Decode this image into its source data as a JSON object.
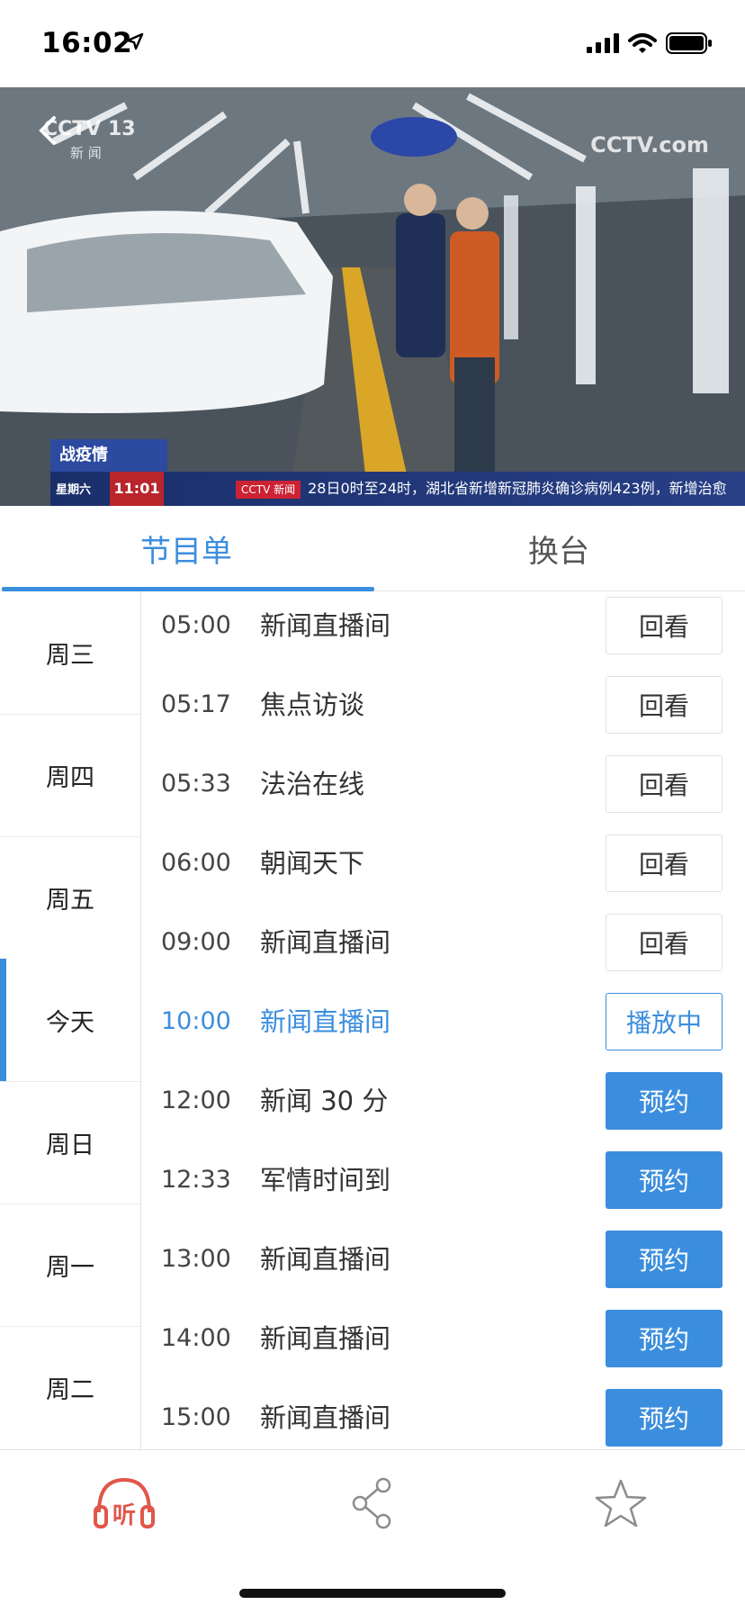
{
  "status_bar": {
    "time": "16:02",
    "icons": [
      "location-arrow-icon",
      "signal-icon",
      "wifi-icon",
      "battery-icon"
    ]
  },
  "video": {
    "watermark_left": "CCTV 13",
    "watermark_left_sub": "新 闻",
    "watermark_right": "CCTV.com",
    "corner_tag": "战疫情",
    "ticker_day": "星期六",
    "ticker_time": "11:01",
    "ticker_logo": "CCTV 新闻",
    "ticker_text": "28日0时至24时，湖北省新增新冠肺炎确诊病例423例，新增治愈"
  },
  "tabs": [
    {
      "label": "节目单",
      "active": true
    },
    {
      "label": "换台",
      "active": false
    }
  ],
  "days": [
    {
      "label": "周三",
      "active": false
    },
    {
      "label": "周四",
      "active": false
    },
    {
      "label": "周五",
      "active": false
    },
    {
      "label": "今天",
      "active": true
    },
    {
      "label": "周日",
      "active": false
    },
    {
      "label": "周一",
      "active": false
    },
    {
      "label": "周二",
      "active": false
    }
  ],
  "schedule": [
    {
      "time": "05:00",
      "title": "新闻直播间",
      "action": "回看",
      "state": "replay"
    },
    {
      "time": "05:17",
      "title": "焦点访谈",
      "action": "回看",
      "state": "replay"
    },
    {
      "time": "05:33",
      "title": "法治在线",
      "action": "回看",
      "state": "replay"
    },
    {
      "time": "06:00",
      "title": "朝闻天下",
      "action": "回看",
      "state": "replay"
    },
    {
      "time": "09:00",
      "title": "新闻直播间",
      "action": "回看",
      "state": "replay"
    },
    {
      "time": "10:00",
      "title": "新闻直播间",
      "action": "播放中",
      "state": "playing"
    },
    {
      "time": "12:00",
      "title": "新闻 30 分",
      "action": "预约",
      "state": "reserve"
    },
    {
      "time": "12:33",
      "title": "军情时间到",
      "action": "预约",
      "state": "reserve"
    },
    {
      "time": "13:00",
      "title": "新闻直播间",
      "action": "预约",
      "state": "reserve"
    },
    {
      "time": "14:00",
      "title": "新闻直播间",
      "action": "预约",
      "state": "reserve"
    },
    {
      "time": "15:00",
      "title": "新闻直播间",
      "action": "预约",
      "state": "reserve"
    }
  ],
  "bottom_bar": {
    "items": [
      {
        "icon": "listen-headphones-icon",
        "label": "听",
        "color": "#e0574a"
      },
      {
        "icon": "share-icon"
      },
      {
        "icon": "star-icon"
      }
    ]
  },
  "colors": {
    "accent": "#3b8ede",
    "listen": "#e0574a"
  }
}
